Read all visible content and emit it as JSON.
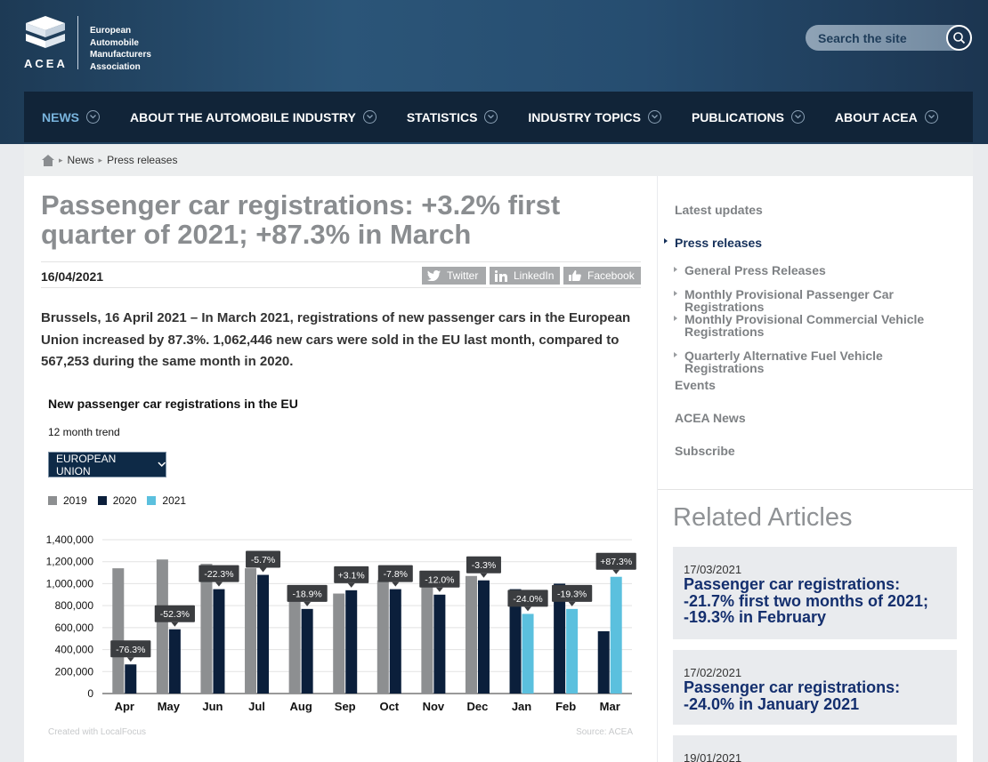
{
  "header": {
    "logo_acronym": "ACEA",
    "logo_lines": [
      "European",
      "Automobile",
      "Manufacturers",
      "Association"
    ],
    "search_placeholder": "Search the site"
  },
  "nav": {
    "items": [
      {
        "label": "NEWS",
        "active": true
      },
      {
        "label": "ABOUT THE AUTOMOBILE INDUSTRY",
        "active": false
      },
      {
        "label": "STATISTICS",
        "active": false
      },
      {
        "label": "INDUSTRY TOPICS",
        "active": false
      },
      {
        "label": "PUBLICATIONS",
        "active": false
      },
      {
        "label": "ABOUT ACEA",
        "active": false
      }
    ]
  },
  "breadcrumb": {
    "items": [
      "News",
      "Press releases"
    ]
  },
  "article": {
    "title": "Passenger car registrations: +3.2% first quarter of 2021; +87.3% in March",
    "date": "16/04/2021",
    "share": {
      "twitter": "Twitter",
      "linkedin": "LinkedIn",
      "facebook": "Facebook"
    },
    "lead": "Brussels, 16 April 2021 – In March 2021, registrations of new passenger cars in the European Union increased by 87.3%. 1,062,446 new cars were sold in the EU last month, compared to 567,253 during the same month in 2020."
  },
  "chart_widget": {
    "title": "New passenger car registrations in the EU",
    "subtitle": "12 month trend",
    "dropdown_label": "EUROPEAN UNION",
    "footer_left": "Created with LocalFocus",
    "footer_right": "Source: ACEA"
  },
  "chart_data": {
    "type": "bar",
    "categories": [
      "Apr",
      "May",
      "Jun",
      "Jul",
      "Aug",
      "Sep",
      "Oct",
      "Nov",
      "Dec",
      "Jan",
      "Feb",
      "Mar"
    ],
    "series": [
      {
        "name": "2019",
        "color": "#8d8f91",
        "values": [
          1140000,
          1220000,
          1180000,
          1140000,
          920000,
          910000,
          1030000,
          1020000,
          1070000,
          null,
          null,
          null
        ]
      },
      {
        "name": "2020",
        "color": "#0b1f3b",
        "values": [
          265000,
          585000,
          950000,
          1080000,
          770000,
          940000,
          950000,
          900000,
          1030000,
          950000,
          1000000,
          567253
        ]
      },
      {
        "name": "2021",
        "color": "#5bc0de",
        "values": [
          null,
          null,
          null,
          null,
          null,
          null,
          null,
          null,
          null,
          725000,
          770000,
          1062446
        ]
      }
    ],
    "change_labels": [
      "-76.3%",
      "-52.3%",
      "-22.3%",
      "-5.7%",
      "-18.9%",
      "+3.1%",
      "-7.8%",
      "-12.0%",
      "-3.3%",
      "-24.0%",
      "-19.3%",
      "+87.3%"
    ],
    "yticks": [
      "0",
      "200,000",
      "400,000",
      "600,000",
      "800,000",
      "1,000,000",
      "1,200,000",
      "1,400,000"
    ],
    "ylim": [
      0,
      1400000
    ],
    "legend": "top-left",
    "grid": true
  },
  "sidebar": {
    "latest_updates": "Latest updates",
    "press_releases": "Press releases",
    "sub_items": [
      "General Press Releases",
      "Monthly Provisional Passenger Car Registrations",
      "Monthly Provisional Commercial Vehicle Registrations",
      "Quarterly Alternative Fuel Vehicle Registrations"
    ],
    "events": "Events",
    "acea_news": "ACEA News",
    "subscribe": "Subscribe"
  },
  "related": {
    "title": "Related Articles",
    "articles": [
      {
        "date": "17/03/2021",
        "title": "Passenger car registrations: -21.7% first two months of 2021; -19.3% in February"
      },
      {
        "date": "17/02/2021",
        "title": "Passenger car registrations: -24.0% in January 2021"
      },
      {
        "date": "19/01/2021",
        "title": ""
      }
    ]
  }
}
